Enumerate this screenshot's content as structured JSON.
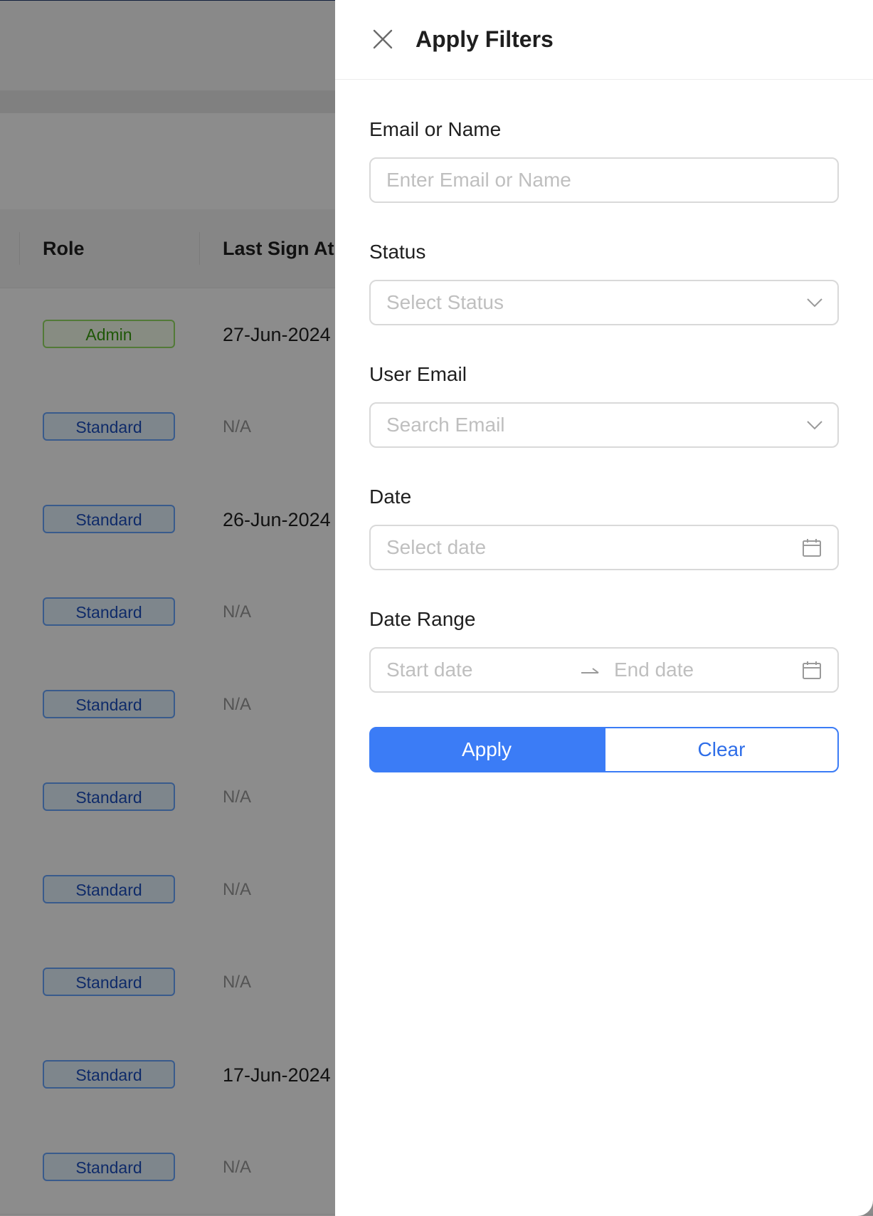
{
  "table": {
    "headers": {
      "role": "Role",
      "last_sign_at": "Last Sign At"
    },
    "rows": [
      {
        "role": "Admin",
        "last_sign_at": "27-Jun-2024"
      },
      {
        "role": "Standard",
        "last_sign_at": "N/A"
      },
      {
        "role": "Standard",
        "last_sign_at": "26-Jun-2024"
      },
      {
        "role": "Standard",
        "last_sign_at": "N/A"
      },
      {
        "role": "Standard",
        "last_sign_at": "N/A"
      },
      {
        "role": "Standard",
        "last_sign_at": "N/A"
      },
      {
        "role": "Standard",
        "last_sign_at": "N/A"
      },
      {
        "role": "Standard",
        "last_sign_at": "N/A"
      },
      {
        "role": "Standard",
        "last_sign_at": "17-Jun-2024"
      },
      {
        "role": "Standard",
        "last_sign_at": "N/A"
      }
    ]
  },
  "drawer": {
    "title": "Apply Filters",
    "close_icon": "close-icon",
    "fields": {
      "email_or_name": {
        "label": "Email or Name",
        "placeholder": "Enter Email or Name",
        "value": ""
      },
      "status": {
        "label": "Status",
        "placeholder": "Select Status",
        "icon": "chevron-down-icon"
      },
      "user_email": {
        "label": "User Email",
        "placeholder": "Search Email",
        "icon": "chevron-down-icon"
      },
      "date": {
        "label": "Date",
        "placeholder": "Select date",
        "icon": "calendar-icon"
      },
      "date_range": {
        "label": "Date Range",
        "start_placeholder": "Start date",
        "end_placeholder": "End date",
        "separator_icon": "arrow-right-icon",
        "icon": "calendar-icon"
      }
    },
    "buttons": {
      "apply": "Apply",
      "clear": "Clear"
    }
  },
  "colors": {
    "primary": "#3b7cf6",
    "admin_tag": "#389e0d",
    "standard_tag": "#1d4fbf",
    "overlay": "rgba(0,0,0,0.45)"
  }
}
